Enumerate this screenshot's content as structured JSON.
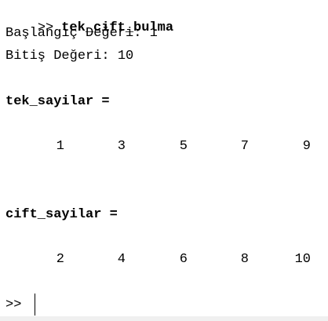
{
  "console": {
    "command": {
      "prompt": ">>",
      "text": "tek_cift_bulma"
    },
    "start_line": "Başlangıç Değeri: 1",
    "end_line": "Bitiş Değeri: 10",
    "odd": {
      "header": "tek_sayilar =",
      "values": [
        "1",
        "3",
        "5",
        "7",
        "9"
      ]
    },
    "even": {
      "header": "cift_sayilar =",
      "values": [
        "2",
        "4",
        "6",
        "8",
        "10"
      ]
    },
    "input_prompt": ">>"
  }
}
